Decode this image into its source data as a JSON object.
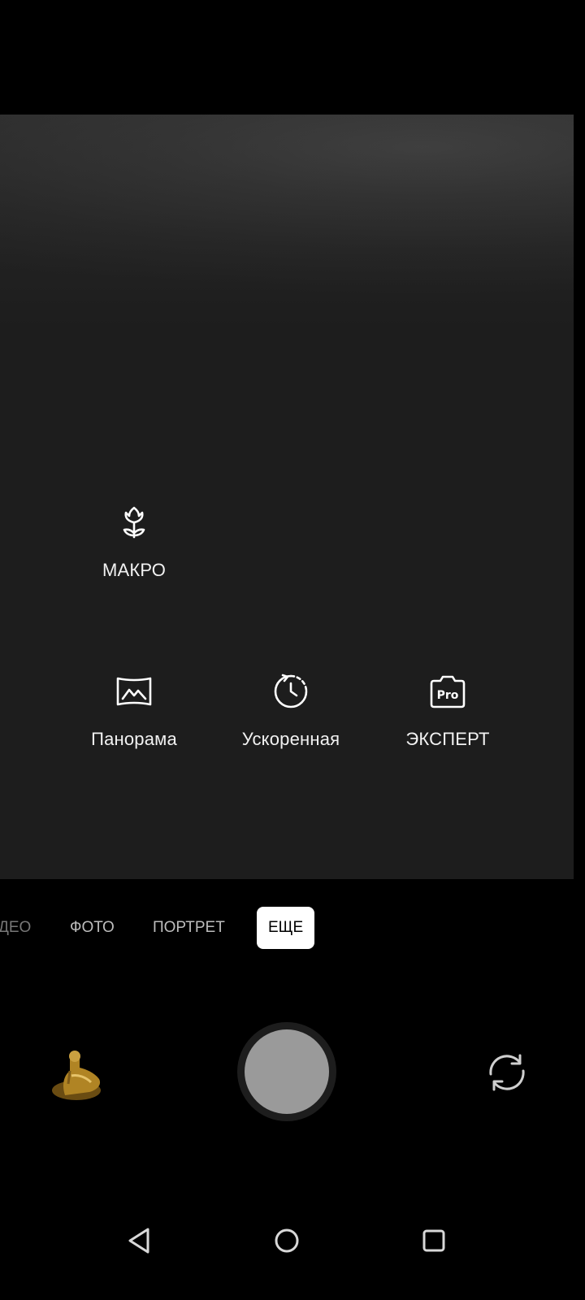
{
  "viewfinder": {
    "modes_row1": [
      {
        "label": "МАКРО",
        "icon": "macro-flower-icon"
      }
    ],
    "modes_row2": [
      {
        "label": "Панорама",
        "icon": "panorama-icon"
      },
      {
        "label": "Ускоренная",
        "icon": "timelapse-icon"
      },
      {
        "label": "ЭКСПЕРТ",
        "icon": "pro-camera-icon"
      }
    ]
  },
  "mode_bar": {
    "tabs": [
      {
        "label": "ДЕО"
      },
      {
        "label": "ФОТО"
      },
      {
        "label": "ПОРТРЕТ"
      },
      {
        "label": "ЕЩЕ"
      }
    ],
    "active_index": 3
  },
  "controls": {
    "gallery_icon": "gallery-thumbnail",
    "shutter_icon": "shutter-button",
    "flip_icon": "switch-camera-icon"
  },
  "nav_bar": {
    "back_icon": "back-icon",
    "home_icon": "home-icon",
    "recents_icon": "recents-icon"
  },
  "colors": {
    "background": "#000000",
    "viewfinder": "#1f1f1f",
    "text": "#ffffff",
    "tab_inactive": "#bdbdbd",
    "active_tab_bg": "#ffffff",
    "shutter": "#9a9a9a"
  }
}
